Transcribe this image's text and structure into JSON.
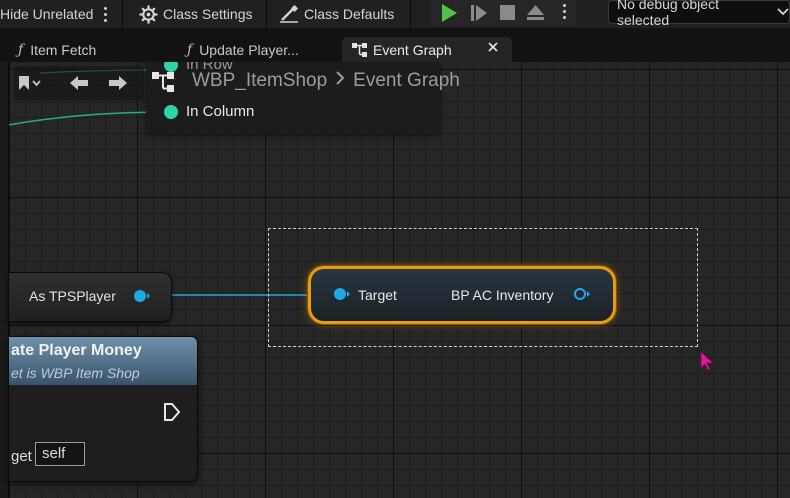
{
  "toolbar": {
    "hide_unrelated": "Hide Unrelated",
    "class_settings": "Class Settings",
    "class_defaults": "Class Defaults",
    "debug_object": "No debug object selected"
  },
  "tabs": [
    {
      "label": "Item Fetch",
      "icon": "function-icon"
    },
    {
      "label": "Update Player...",
      "icon": "function-icon"
    },
    {
      "label": "Event Graph",
      "icon": "event-graph-icon"
    }
  ],
  "breadcrumb": {
    "asset": "WBP_ItemShop",
    "graph": "Event Graph"
  },
  "popup": {
    "row_pin": "In Row",
    "column_pin": "In Column"
  },
  "nodes": {
    "as_tps_player": "As TPSPlayer",
    "target_pin": "Target",
    "output_pin": "BP AC Inventory",
    "update_money_title": "ate Player Money",
    "update_money_subtitle": "et is WBP Item Shop",
    "target_label": "get",
    "target_value": "self"
  },
  "colors": {
    "selection": "#e89a11",
    "object_pin": "#1fa7e6",
    "struct_pin": "#2fd3a8",
    "play_green": "#52c24a",
    "cursor": "#e0169b"
  }
}
